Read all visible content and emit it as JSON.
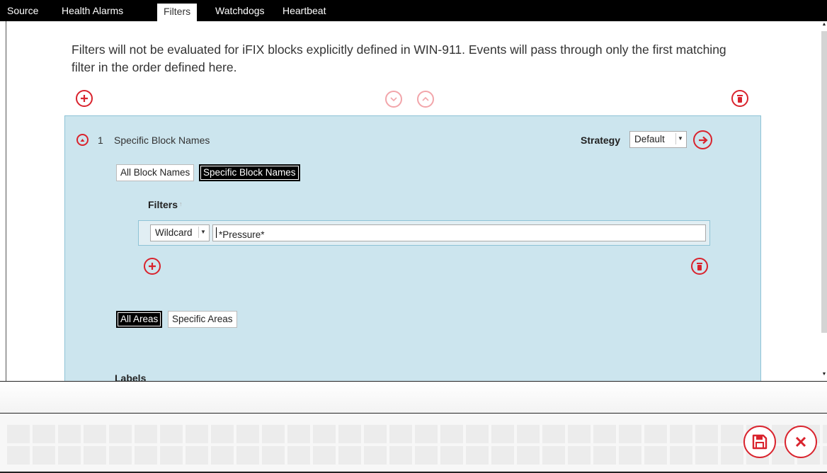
{
  "tabs": [
    {
      "label": "Source"
    },
    {
      "label": "Health Alarms"
    },
    {
      "label": "Filters"
    },
    {
      "label": "Watchdogs"
    },
    {
      "label": "Heartbeat"
    }
  ],
  "active_tab": "Filters",
  "description": "Filters will not be evaluated for iFIX blocks explicitly defined in WIN-911. Events will pass through only the first matching filter in the order defined here.",
  "filter_item": {
    "number": "1",
    "title": "Specific Block Names",
    "strategy_label": "Strategy",
    "strategy_value": "Default",
    "block_names_options": [
      "All Block Names",
      "Specific Block Names"
    ],
    "block_names_selected": "Specific Block Names",
    "filters_label": "Filters",
    "filters_sort_indicator": "↑",
    "filter_rows": [
      {
        "match_type": "Wildcard",
        "pattern": "*Pressure*"
      }
    ],
    "area_options": [
      "All Areas",
      "Specific Areas"
    ],
    "area_selected": "All Areas",
    "labels_label": "Labels"
  },
  "icons": {
    "add": "plus-circle-icon",
    "delete": "trash-icon",
    "move_down": "chevron-down-icon",
    "move_up": "chevron-up-icon",
    "collapse": "caret-up-icon",
    "go": "arrow-right-icon",
    "save": "floppy-disk-icon",
    "cancel": "close-icon"
  },
  "colors": {
    "accent": "#d9232d",
    "accent_disabled": "#f2a5aa",
    "panel_bg": "#cce5ee",
    "tabbar_bg": "#000000"
  }
}
